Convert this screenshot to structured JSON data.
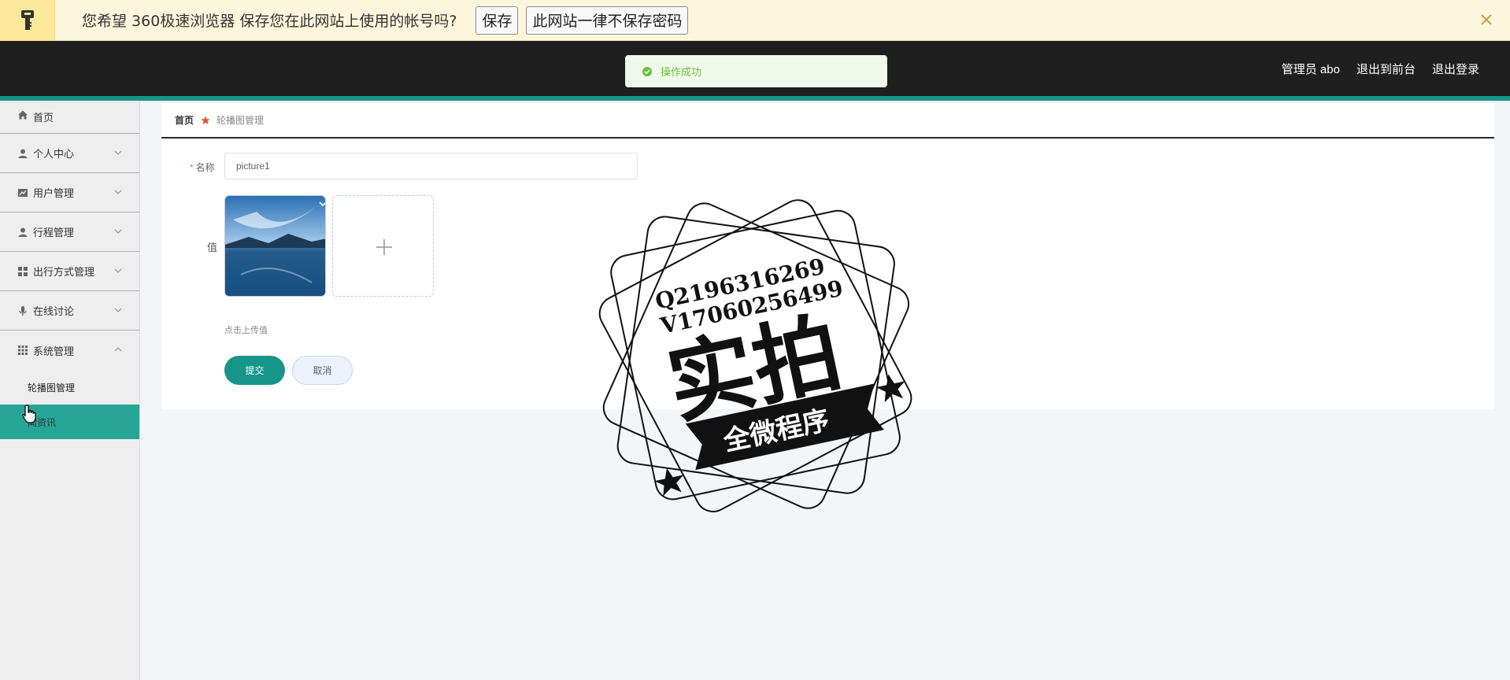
{
  "password_bar": {
    "message": "您希望 360极速浏览器 保存您在此网站上使用的帐号吗?",
    "save_label": "保存",
    "never_label": "此网站一律不保存密码",
    "icons": [
      "key-icon",
      "close-icon"
    ]
  },
  "header": {
    "links": [
      "管理员 abo",
      "退出到前台",
      "退出登录"
    ]
  },
  "toast": {
    "message": "操作成功",
    "icon": "success-icon"
  },
  "sidebar": {
    "items": [
      {
        "label": "首页",
        "icon": "home-icon"
      },
      {
        "label": "个人中心",
        "icon": "user-icon"
      },
      {
        "label": "用户管理",
        "icon": "chart-icon"
      },
      {
        "label": "行程管理",
        "icon": "user-icon"
      },
      {
        "label": "出行方式管理",
        "icon": "grid-icon"
      },
      {
        "label": "在线讨论",
        "icon": "mic-icon"
      },
      {
        "label": "系统管理",
        "icon": "apps-icon"
      }
    ],
    "sub_items": [
      "轮播图管理",
      "闻资讯"
    ]
  },
  "breadcrumb": {
    "home": "首页",
    "current": "轮播图管理"
  },
  "form": {
    "name_label": "名称",
    "name_required": "*",
    "name_value": "picture1",
    "value_label": "值",
    "upload_tip": "点击上传值",
    "submit_label": "提交",
    "cancel_label": "取消"
  },
  "watermark": {
    "line1": "Q2196316269",
    "line2": "V17060256499",
    "big": "实拍",
    "ribbon": "全微程序"
  },
  "colors": {
    "accent": "#169588",
    "header": "#1f1f1f",
    "sidebar_active": "#27a597"
  }
}
